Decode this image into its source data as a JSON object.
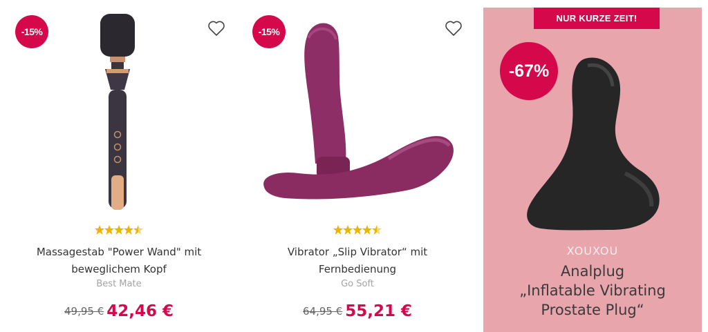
{
  "colors": {
    "accent": "#d4084b",
    "star": "#f0b400",
    "promo_bg": "#e9a5ac"
  },
  "products": [
    {
      "discount": "-15%",
      "rating": 4.5,
      "title_line1": "Massagestab \"Power Wand\" mit",
      "title_line2": "beweglichem Kopf",
      "brand": "Best Mate",
      "old_price": "49,95 €",
      "new_price": "42,46 €",
      "icon": "heart-icon"
    },
    {
      "discount": "-15%",
      "rating": 4.5,
      "title_line1": "Vibrator „Slip Vibrator“ mit",
      "title_line2": "Fernbedienung",
      "brand": "Go Soft",
      "old_price": "64,95 €",
      "new_price": "55,21 €",
      "icon": "heart-icon"
    }
  ],
  "promo": {
    "tag": "NUR KURZE ZEIT!",
    "discount": "-67%",
    "brand": "XOUXOU",
    "name_line1": "Analplug",
    "name_line2": "„Inflatable Vibrating",
    "name_line3": "Prostate Plug“"
  }
}
